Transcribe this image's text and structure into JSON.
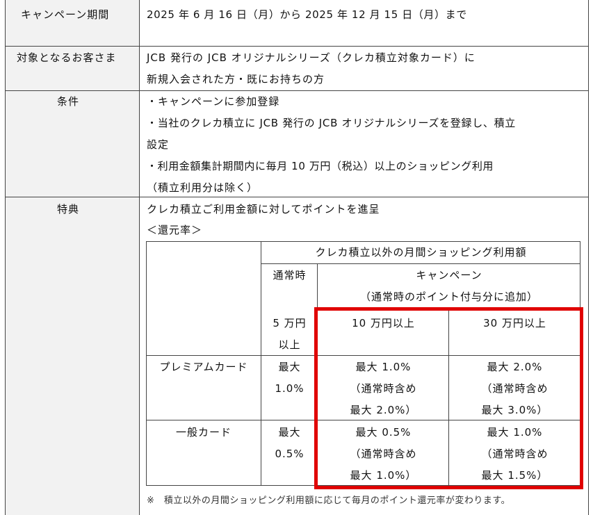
{
  "period": {
    "label": "キャンペーン期間",
    "value": "2025 年 6 月 16 日（月）から 2025 年 12 月 15 日（月）まで"
  },
  "target": {
    "label": "対象となるお客さま",
    "line1": "JCB 発行の JCB オリジナルシリーズ（クレカ積立対象カード）に",
    "line2": "新規入会された方・既にお持ちの方"
  },
  "conditions": {
    "label": "条件",
    "lines": [
      "・キャンペーンに参加登録",
      "・当社のクレカ積立に JCB 発行の JCB オリジナルシリーズを登録し、積立",
      "設定",
      "・利用金額集計期間内に毎月 10 万円（税込）以上のショッピング利用",
      "（積立利用分は除く）"
    ]
  },
  "benefit": {
    "label": "特典",
    "line1": "クレカ積立ご利用金額に対してポイントを進呈",
    "rate_title": "＜還元率＞",
    "table": {
      "header_main": "クレカ積立以外の月間ショッピング利用額",
      "col_normal": "通常時",
      "col_campaign": "キャンペーン",
      "col_campaign_sub": "（通常時のポイント付与分に追加）",
      "tier_5_line1": "5 万円",
      "tier_5_line2": "以上",
      "tier_10": "10 万円以上",
      "tier_30": "30 万円以上",
      "rows": [
        {
          "name": "プレミアムカード",
          "normal_1": "最大",
          "normal_2": "1.0%",
          "c10_1": "最大 1.0%",
          "c10_2": "（通常時含め",
          "c10_3": "最大 2.0%）",
          "c30_1": "最大 2.0%",
          "c30_2": "（通常時含め",
          "c30_3": "最大 3.0%）"
        },
        {
          "name": "一般カード",
          "normal_1": "最大",
          "normal_2": "0.5%",
          "c10_1": "最大 0.5%",
          "c10_2": "（通常時含め",
          "c10_3": "最大 1.0%）",
          "c30_1": "最大 1.0%",
          "c30_2": "（通常時含め",
          "c30_3": "最大 1.5%）"
        }
      ]
    },
    "note": "※　積立以外の月間ショッピング利用額に応じて毎月のポイント還元率が変わります。"
  },
  "colors": {
    "highlight": "#e00000",
    "label_bg": "#f2f2f2",
    "border": "#444444"
  }
}
